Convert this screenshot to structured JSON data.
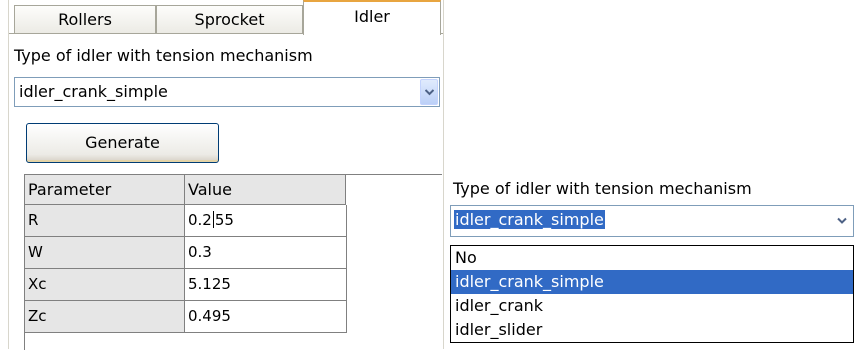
{
  "tabs": {
    "rollers": "Rollers",
    "sprocket": "Sprocket",
    "idler": "Idler"
  },
  "left": {
    "type_label": "Type of idler with tension mechanism",
    "combo_value": "idler_crank_simple",
    "generate_label": "Generate",
    "grid": {
      "headers": [
        "Parameter",
        "Value"
      ],
      "rows": [
        {
          "param": "R",
          "value_pre": "0.2",
          "value_post": "55"
        },
        {
          "param": "W",
          "value": "0.3"
        },
        {
          "param": "Xc",
          "value": "5.125"
        },
        {
          "param": "Zc",
          "value": "0.495"
        }
      ]
    }
  },
  "right": {
    "type_label": "Type of idler with tension mechanism",
    "combo_value": "idler_crank_simple",
    "options": [
      "No",
      "idler_crank_simple",
      "idler_crank",
      "idler_slider"
    ],
    "highlighted_option": "idler_crank_simple"
  },
  "colors": {
    "selection": "#316ac5",
    "tab_accent": "#e8a540",
    "grid_header": "#e6e6e6"
  }
}
